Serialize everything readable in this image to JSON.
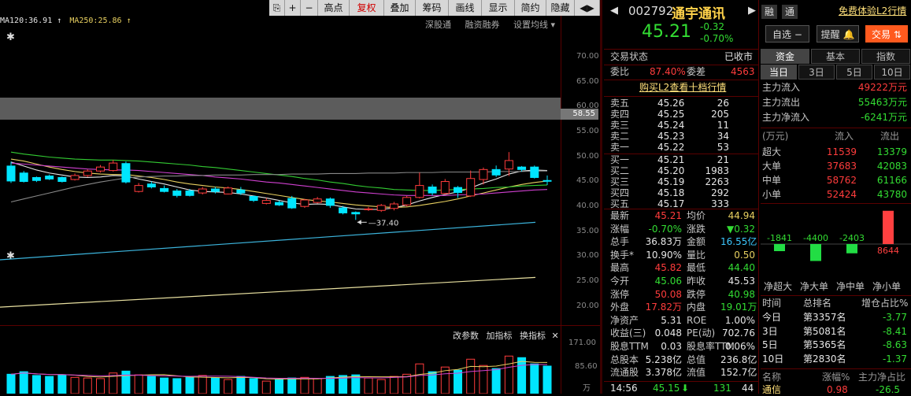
{
  "toolbar": {
    "items": [
      "⎘",
      "+",
      "−",
      "高点",
      "复权",
      "叠加",
      "筹码",
      "画线",
      "显示",
      "简约",
      "隐藏",
      "◀▶"
    ]
  },
  "ma": {
    "ma120": "MA120:36.91",
    "ma250": "MA250:25.86"
  },
  "chart_links": [
    "深股通",
    "融资融券",
    "设置均线"
  ],
  "y_axis": [
    "70.00",
    "65.00",
    "60.00",
    "55.00",
    "50.00",
    "45.00",
    "40.00",
    "35.00",
    "30.00",
    "25.00",
    "20.00"
  ],
  "current_price_tag": "58.55",
  "low_label": "37.40",
  "sub_links": [
    "改参数",
    "加指标",
    "换指标"
  ],
  "vol_axis": [
    "171.00",
    "85.60",
    "万"
  ],
  "chart_data": {
    "type": "candlestick",
    "ylim": [
      15.5,
      75.5
    ],
    "candles": [
      {
        "o": 48.2,
        "c": 45.2,
        "h": 49.1,
        "l": 44.8
      },
      {
        "o": 46.8,
        "c": 45.1,
        "h": 47.2,
        "l": 44.9
      },
      {
        "o": 45.9,
        "c": 45.3,
        "h": 46.1,
        "l": 45.0
      },
      {
        "o": 46.2,
        "c": 45.6,
        "h": 46.5,
        "l": 45.4
      },
      {
        "o": 45.9,
        "c": 45.1,
        "h": 46.1,
        "l": 44.9
      },
      {
        "o": 45.5,
        "c": 46.3,
        "h": 46.7,
        "l": 45.3
      },
      {
        "o": 46.3,
        "c": 47.2,
        "h": 47.5,
        "l": 46.0
      },
      {
        "o": 47.2,
        "c": 48.0,
        "h": 48.4,
        "l": 46.9
      },
      {
        "o": 47.3,
        "c": 48.8,
        "h": 49.4,
        "l": 47.1
      },
      {
        "o": 48.7,
        "c": 45.0,
        "h": 49.1,
        "l": 44.7
      },
      {
        "o": 43.1,
        "c": 44.3,
        "h": 44.8,
        "l": 42.9
      },
      {
        "o": 44.6,
        "c": 44.0,
        "h": 45.1,
        "l": 43.7
      },
      {
        "o": 43.7,
        "c": 43.1,
        "h": 44.3,
        "l": 42.9
      },
      {
        "o": 43.2,
        "c": 42.3,
        "h": 43.6,
        "l": 41.9
      },
      {
        "o": 43.2,
        "c": 42.3,
        "h": 43.6,
        "l": 42.1
      },
      {
        "o": 42.8,
        "c": 43.6,
        "h": 44.0,
        "l": 42.5
      },
      {
        "o": 43.6,
        "c": 43.1,
        "h": 44.0,
        "l": 42.7
      },
      {
        "o": 42.6,
        "c": 43.8,
        "h": 44.1,
        "l": 42.5
      },
      {
        "o": 43.4,
        "c": 42.8,
        "h": 44.0,
        "l": 42.4
      },
      {
        "o": 42.1,
        "c": 41.3,
        "h": 42.3,
        "l": 41.0
      },
      {
        "o": 40.7,
        "c": 41.3,
        "h": 41.8,
        "l": 40.5
      },
      {
        "o": 40.9,
        "c": 40.4,
        "h": 41.3,
        "l": 40.2
      },
      {
        "o": 41.7,
        "c": 39.8,
        "h": 42.2,
        "l": 39.6
      },
      {
        "o": 40.1,
        "c": 41.4,
        "h": 41.6,
        "l": 39.8
      },
      {
        "o": 40.9,
        "c": 41.6,
        "h": 42.0,
        "l": 40.7
      },
      {
        "o": 41.6,
        "c": 40.3,
        "h": 41.9,
        "l": 39.8
      },
      {
        "o": 39.8,
        "c": 38.8,
        "h": 40.2,
        "l": 38.5
      },
      {
        "o": 38.9,
        "c": 38.6,
        "h": 39.1,
        "l": 37.4
      },
      {
        "o": 39.5,
        "c": 39.6,
        "h": 40.0,
        "l": 39.2
      },
      {
        "o": 39.3,
        "c": 40.3,
        "h": 40.6,
        "l": 39.0
      },
      {
        "o": 39.7,
        "c": 40.6,
        "h": 41.0,
        "l": 39.3
      },
      {
        "o": 40.4,
        "c": 41.9,
        "h": 42.2,
        "l": 40.1
      },
      {
        "o": 41.9,
        "c": 44.3,
        "h": 46.9,
        "l": 41.7
      },
      {
        "o": 44.0,
        "c": 42.8,
        "h": 44.5,
        "l": 42.3
      },
      {
        "o": 42.7,
        "c": 45.1,
        "h": 45.6,
        "l": 42.5
      },
      {
        "o": 43.9,
        "c": 42.9,
        "h": 44.2,
        "l": 41.8
      },
      {
        "o": 42.2,
        "c": 45.7,
        "h": 47.3,
        "l": 42.0
      },
      {
        "o": 45.5,
        "c": 47.5,
        "h": 47.9,
        "l": 44.5
      },
      {
        "o": 47.5,
        "c": 46.4,
        "h": 48.3,
        "l": 46.0
      },
      {
        "o": 47.6,
        "c": 49.3,
        "h": 51.0,
        "l": 46.2
      },
      {
        "o": 48.0,
        "c": 47.5,
        "h": 48.2,
        "l": 47.1
      },
      {
        "o": 48.0,
        "c": 45.9,
        "h": 48.3,
        "l": 45.7
      },
      {
        "o": 45.3,
        "c": 45.2,
        "h": 46.3,
        "l": 44.4
      }
    ],
    "ma_lines": [
      {
        "color": "#e6e6e6",
        "values": [
          49.0,
          48.2,
          47.4,
          46.8,
          46.4,
          46.0,
          45.9,
          46.0,
          46.3,
          46.2,
          45.6,
          45.1,
          44.6,
          44.0,
          43.4,
          43.1,
          43.0,
          42.9,
          42.6,
          42.2,
          41.8,
          41.3,
          40.8,
          40.5,
          40.6,
          40.5,
          40.0,
          39.6,
          39.5,
          39.5,
          39.8,
          40.4,
          41.2,
          41.9,
          42.5,
          43.0,
          43.8,
          44.8,
          45.6,
          46.6,
          47.2,
          47.4,
          47.3
        ]
      },
      {
        "color": "#e8d060",
        "values": [
          49.6,
          49.2,
          48.6,
          48.0,
          47.5,
          47.1,
          46.8,
          46.6,
          46.5,
          46.5,
          46.2,
          45.9,
          45.5,
          45.0,
          44.6,
          44.3,
          44.0,
          43.8,
          43.5,
          43.1,
          42.7,
          42.3,
          41.9,
          41.5,
          41.2,
          41.0,
          40.7,
          40.4,
          40.2,
          40.0,
          39.9,
          40.0,
          40.3,
          40.7,
          41.1,
          41.6,
          42.2,
          42.8,
          43.4,
          44.0,
          44.5,
          44.9,
          45.2
        ]
      },
      {
        "color": "#d040d0",
        "values": [
          48.8,
          48.6,
          48.4,
          48.2,
          48.0,
          47.8,
          47.6,
          47.5,
          47.4,
          47.4,
          47.3,
          47.1,
          46.9,
          46.7,
          46.5,
          46.3,
          46.0,
          45.8,
          45.6,
          45.3,
          45.0,
          44.8,
          44.5,
          44.2,
          43.9,
          43.6,
          43.3,
          43.0,
          42.8,
          42.6,
          42.4,
          42.3,
          42.3,
          42.3,
          42.3,
          42.4,
          42.5,
          42.6,
          42.8,
          43.0,
          43.2,
          43.4,
          43.5
        ]
      },
      {
        "color": "#33cc33",
        "values": [
          51.0,
          50.6,
          50.3,
          50.0,
          49.8,
          49.6,
          49.5,
          49.4,
          49.4,
          49.3,
          49.2,
          49.0,
          48.8,
          48.6,
          48.4,
          48.1,
          47.9,
          47.6,
          47.3,
          47.0,
          46.7,
          46.4,
          46.1,
          45.7,
          45.4,
          45.0,
          44.7,
          44.3,
          44.0,
          43.8,
          43.5,
          43.4,
          43.3,
          43.3,
          43.4,
          43.5,
          43.6,
          43.7,
          43.9,
          44.0,
          44.2,
          44.3,
          44.4
        ]
      },
      {
        "color": "#888888",
        "values": [
          41.0,
          41.6,
          42.2,
          42.8,
          43.4,
          44.0,
          44.5,
          45.0,
          45.4,
          45.8,
          46.0,
          46.1,
          46.2,
          46.2,
          46.3,
          46.3,
          46.4,
          46.4,
          46.4,
          46.5,
          46.5,
          46.5,
          46.6,
          46.6,
          46.6,
          46.7,
          46.7,
          46.7,
          46.8,
          46.8,
          46.8,
          46.9,
          46.9,
          46.9,
          47.0,
          47.0,
          47.0,
          47.0,
          47.1,
          47.1,
          47.1,
          47.2,
          47.2
        ]
      }
    ],
    "long_ma": [
      {
        "name": "MA120",
        "color": "#3cb4dc",
        "start": 29.4,
        "end": 36.91
      },
      {
        "name": "MA250",
        "color": "#e8e0a0",
        "start": 19.9,
        "end": 25.86
      }
    ],
    "volume": [
      62,
      70,
      58,
      55,
      60,
      52,
      50,
      48,
      66,
      72,
      60,
      55,
      50,
      48,
      52,
      58,
      50,
      45,
      55,
      48,
      40,
      45,
      50,
      52,
      48,
      55,
      58,
      60,
      50,
      45,
      55,
      62,
      95,
      70,
      85,
      75,
      110,
      90,
      80,
      120,
      115,
      95,
      88
    ],
    "vol_ylim": [
      0,
      171
    ]
  },
  "header": {
    "code": "002792",
    "name": "通宇通讯",
    "price": "45.21",
    "change": "-0.32",
    "change_pct": "-0.70%",
    "promo": "免费体验L2行情",
    "rong": "融",
    "tong": "通",
    "btn_self": "自选",
    "btn_alert": "提醒",
    "btn_trade": "交易"
  },
  "status": {
    "label": "交易状态",
    "value": "已收市"
  },
  "weibi": {
    "label1": "委比",
    "v1": "87.40%",
    "label2": "委差",
    "v2": "4563"
  },
  "l2_link": "购买L2查看十档行情",
  "sell": [
    {
      "l": "卖五",
      "p": "45.26",
      "v": "26"
    },
    {
      "l": "卖四",
      "p": "45.25",
      "v": "205"
    },
    {
      "l": "卖三",
      "p": "45.24",
      "v": "11"
    },
    {
      "l": "卖二",
      "p": "45.23",
      "v": "34"
    },
    {
      "l": "卖一",
      "p": "45.22",
      "v": "53"
    }
  ],
  "buy": [
    {
      "l": "买一",
      "p": "45.21",
      "v": "21"
    },
    {
      "l": "买二",
      "p": "45.20",
      "v": "1983"
    },
    {
      "l": "买三",
      "p": "45.19",
      "v": "2263"
    },
    {
      "l": "买四",
      "p": "45.18",
      "v": "292"
    },
    {
      "l": "买五",
      "p": "45.17",
      "v": "333"
    }
  ],
  "stats": [
    [
      "最新",
      "45.21",
      "均价",
      "44.94"
    ],
    [
      "涨幅",
      "-0.70%",
      "涨跌",
      "▼0.32"
    ],
    [
      "总手",
      "36.83万",
      "金额",
      "16.55亿"
    ],
    [
      "换手*",
      "10.90%",
      "量比",
      "0.50"
    ],
    [
      "最高",
      "45.82",
      "最低",
      "44.40"
    ],
    [
      "今开",
      "45.06",
      "昨收",
      "45.53"
    ],
    [
      "涨停",
      "50.08",
      "跌停",
      "40.98"
    ],
    [
      "外盘",
      "17.82万",
      "内盘",
      "19.01万"
    ],
    [
      "净资产",
      "5.31",
      "ROE",
      "1.00%"
    ],
    [
      "收益(三)",
      "0.048",
      "PE(动)",
      "702.76"
    ],
    [
      "股息TTM",
      "0.03",
      "股息率TTM",
      "0.06%"
    ],
    [
      "总股本",
      "5.238亿",
      "总值",
      "236.8亿"
    ],
    [
      "流通股",
      "3.378亿",
      "流值",
      "152.7亿"
    ]
  ],
  "tick": {
    "time": "14:56",
    "price": "45.15",
    "vol": "131",
    "num": "44"
  },
  "fund": {
    "tabs": [
      "资金",
      "基本",
      "指数"
    ],
    "periods": [
      "当日",
      "3日",
      "5日",
      "10日"
    ],
    "flows": [
      {
        "l": "主力流入",
        "v": "49222万元"
      },
      {
        "l": "主力流出",
        "v": "55463万元"
      },
      {
        "l": "主力净流入",
        "v": "-6241万元"
      }
    ],
    "table_head": [
      "(万元)",
      "流入",
      "流出"
    ],
    "table": [
      {
        "l": "超大",
        "in": "11539",
        "out": "13379"
      },
      {
        "l": "大单",
        "in": "37683",
        "out": "42083"
      },
      {
        "l": "中单",
        "in": "58762",
        "out": "61166"
      },
      {
        "l": "小单",
        "in": "52424",
        "out": "43780"
      }
    ],
    "bars": [
      {
        "v": -1841,
        "label": "-1841"
      },
      {
        "v": -4400,
        "label": "-4400"
      },
      {
        "v": -2403,
        "label": "-2403"
      },
      {
        "v": 8644,
        "label": "8644"
      }
    ],
    "bar_labels": [
      "净超大",
      "净大单",
      "净中单",
      "净小单"
    ],
    "rank_head": [
      "时间",
      "总排名",
      "增仓占比%"
    ],
    "rank": [
      {
        "t": "今日",
        "r": "第3357名",
        "p": "-3.77"
      },
      {
        "t": "3日",
        "r": "第5081名",
        "p": "-8.41"
      },
      {
        "t": "5日",
        "r": "第5365名",
        "p": "-8.63"
      },
      {
        "t": "10日",
        "r": "第2830名",
        "p": "-1.37"
      }
    ],
    "bottom_head": [
      "名称",
      "涨幅%",
      "主力净占比"
    ],
    "bottom_row": [
      "通信",
      "0.98",
      "-26.5"
    ]
  }
}
